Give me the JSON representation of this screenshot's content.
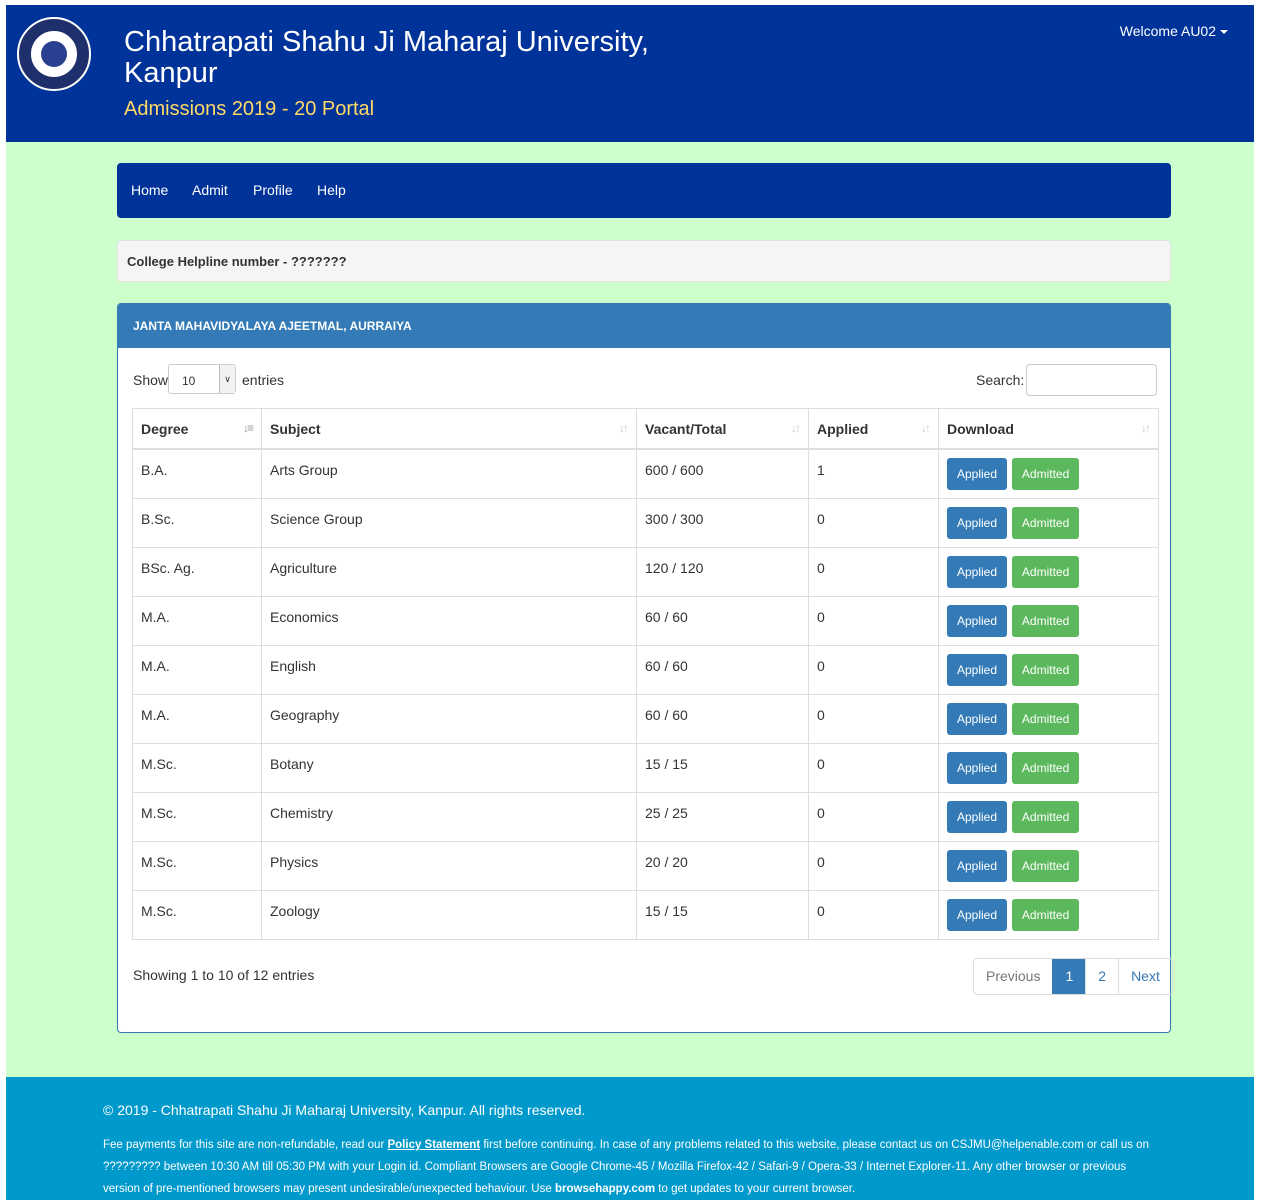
{
  "header": {
    "university": "Chhatrapati Shahu Ji Maharaj University, Kanpur",
    "portal": "Admissions 2019 - 20 Portal",
    "welcome": "Welcome AU02"
  },
  "nav": {
    "items": [
      "Home",
      "Admit",
      "Profile",
      "Help"
    ]
  },
  "helpline": "College Helpline number - ???????",
  "panel": {
    "title": "JANTA MAHAVIDYALAYA AJEETMAL, AURRAIYA"
  },
  "controls": {
    "show": "Show",
    "entries_value": "10",
    "entries": "entries",
    "search": "Search:",
    "search_value": ""
  },
  "table": {
    "columns": [
      "Degree",
      "Subject",
      "Vacant/Total",
      "Applied",
      "Download"
    ],
    "applied_button": "Applied",
    "admitted_button": "Admitted",
    "rows": [
      {
        "degree": "B.A.",
        "subject": "Arts Group",
        "vacant_total": "600 / 600",
        "applied": "1"
      },
      {
        "degree": "B.Sc.",
        "subject": "Science Group",
        "vacant_total": "300 / 300",
        "applied": "0"
      },
      {
        "degree": "BSc. Ag.",
        "subject": "Agriculture",
        "vacant_total": "120 / 120",
        "applied": "0"
      },
      {
        "degree": "M.A.",
        "subject": "Economics",
        "vacant_total": "60 / 60",
        "applied": "0"
      },
      {
        "degree": "M.A.",
        "subject": "English",
        "vacant_total": "60 / 60",
        "applied": "0"
      },
      {
        "degree": "M.A.",
        "subject": "Geography",
        "vacant_total": "60 / 60",
        "applied": "0"
      },
      {
        "degree": "M.Sc.",
        "subject": "Botany",
        "vacant_total": "15 / 15",
        "applied": "0"
      },
      {
        "degree": "M.Sc.",
        "subject": "Chemistry",
        "vacant_total": "25 / 25",
        "applied": "0"
      },
      {
        "degree": "M.Sc.",
        "subject": "Physics",
        "vacant_total": "20 / 20",
        "applied": "0"
      },
      {
        "degree": "M.Sc.",
        "subject": "Zoology",
        "vacant_total": "15 / 15",
        "applied": "0"
      }
    ]
  },
  "pagination": {
    "info": "Showing 1 to 10 of 12 entries",
    "previous": "Previous",
    "pages": [
      "1",
      "2"
    ],
    "next": "Next"
  },
  "footer": {
    "copyright": "© 2019 - Chhatrapati Shahu Ji Maharaj University, Kanpur. All rights reserved.",
    "text1": "Fee payments for this site are non-refundable, read our",
    "policy_link": "Policy Statement",
    "text2": "first before continuing. In case of any problems related to this website, please contact us on CSJMU@helpenable.com or call us on ????????? between 10:30 AM till 05:30 PM with your Login id. Compliant Browsers are Google Chrome-45 / Mozilla Firefox-42 / Safari-9 / Opera-33 / Internet Explorer-11. Any other browser or previous version of pre-mentioned browsers may present undesirable/unexpected behaviour. Use",
    "browse_link": "browsehappy.com",
    "text3": "to get updates to your current browser."
  },
  "icons": [
    "university-logo-icon",
    "caret-down-icon",
    "chevron-down-icon",
    "sort-icon"
  ]
}
